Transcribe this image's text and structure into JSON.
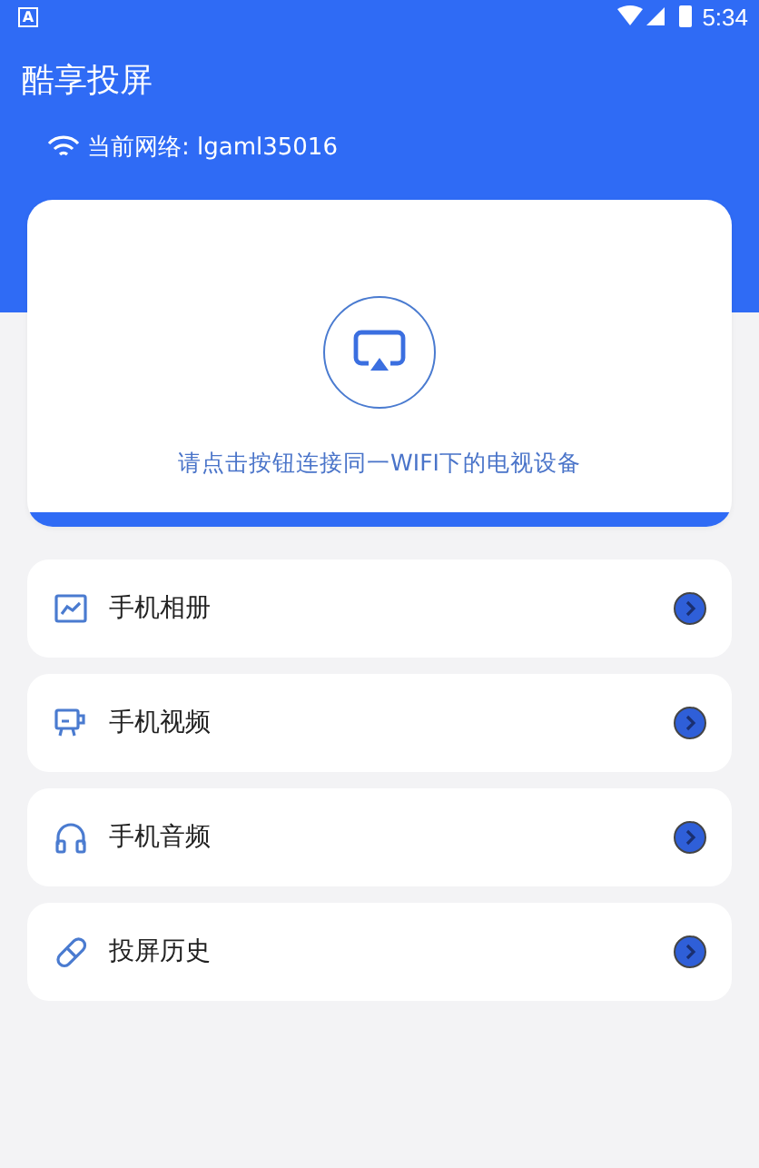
{
  "status_bar": {
    "notification": "A",
    "time": "5:34"
  },
  "app_title": "酷享投屏",
  "network": {
    "label": "当前网络: lgaml35016"
  },
  "cast_card": {
    "hint": "请点击按钮连接同一WIFI下的电视设备"
  },
  "menu": [
    {
      "kind": "album",
      "label": "手机相册"
    },
    {
      "kind": "video",
      "label": "手机视频"
    },
    {
      "kind": "audio",
      "label": "手机音频"
    },
    {
      "kind": "history",
      "label": "投屏历史"
    }
  ]
}
